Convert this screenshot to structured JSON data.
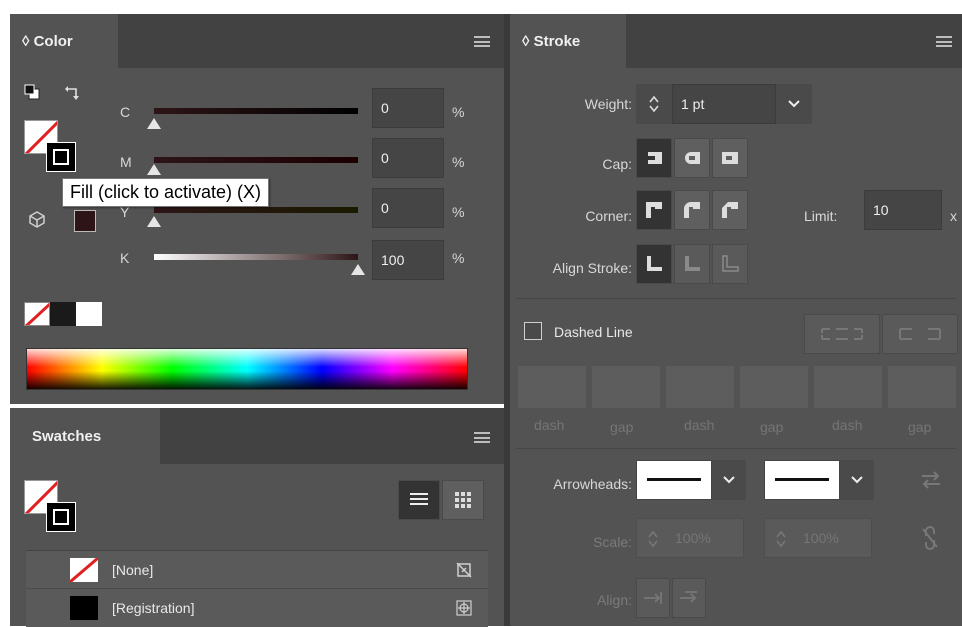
{
  "color_panel": {
    "tab_label": "◊ Color",
    "channels": [
      {
        "label": "C",
        "value": "0",
        "unit": "%",
        "level": 0
      },
      {
        "label": "M",
        "value": "0",
        "unit": "%",
        "level": 0
      },
      {
        "label": "Y",
        "value": "0",
        "unit": "%",
        "level": 0
      },
      {
        "label": "K",
        "value": "100",
        "unit": "%",
        "level": 1
      }
    ],
    "tooltip": "Fill (click to activate) (X)"
  },
  "swatches_panel": {
    "tab_label": "Swatches",
    "items": [
      {
        "name": "[None]"
      },
      {
        "name": "[Registration]"
      }
    ]
  },
  "stroke_panel": {
    "tab_label": "◊ Stroke",
    "weight_label": "Weight:",
    "weight_value": "1 pt",
    "cap_label": "Cap:",
    "corner_label": "Corner:",
    "limit_label": "Limit:",
    "limit_value": "10",
    "limit_unit": "x",
    "align_stroke_label": "Align Stroke:",
    "dashed_line_label": "Dashed Line",
    "dash_labels": [
      "dash",
      "gap",
      "dash",
      "gap",
      "dash",
      "gap"
    ],
    "arrowheads_label": "Arrowheads:",
    "scale_label": "Scale:",
    "scale_start": "100%",
    "scale_end": "100%",
    "align_label": "Align:"
  },
  "colors": {
    "panel_bg": "#535353",
    "tabbar_bg": "#424242",
    "field_bg": "#454545",
    "fill_color": "#2d1517"
  }
}
